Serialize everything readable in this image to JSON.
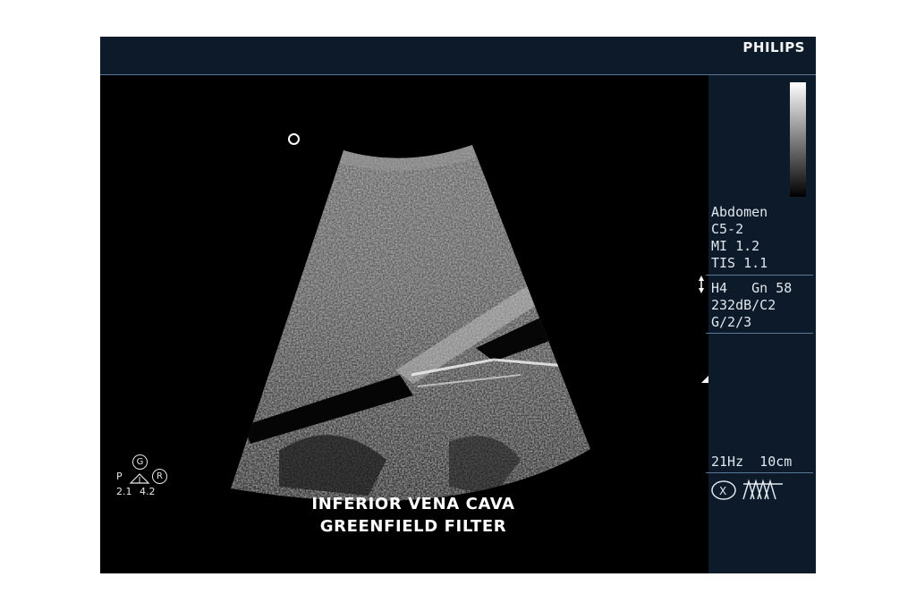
{
  "header": {
    "brand": "PHILIPS"
  },
  "side_panel": {
    "preset": "Abdomen",
    "transducer": "C5-2",
    "mi": "MI 1.2",
    "tis": "TIS 1.1",
    "harmonic_gain": "H4   Gn 58",
    "dynamic_range": "232dB/C2",
    "g_setting": "G/2/3",
    "frame_depth": "21Hz  10cm"
  },
  "orientation": {
    "g": "G",
    "r": "R",
    "p": "P",
    "v1": "2.1",
    "v2": "4.2"
  },
  "caption": {
    "line1": "INFERIOR VENA CAVA",
    "line2": "GREENFIELD FILTER"
  },
  "colors": {
    "panel_bg": "#0c1a2a",
    "accent_line": "#5a7896",
    "text": "#dfe6ec"
  }
}
